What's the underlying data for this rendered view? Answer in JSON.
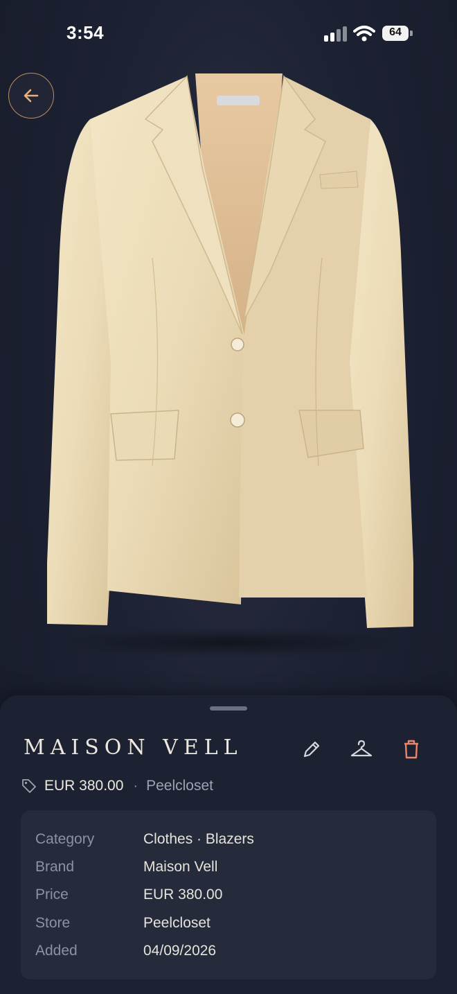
{
  "status_bar": {
    "time": "3:54",
    "battery_level": "64"
  },
  "icons": {
    "back": "arrow-left-icon",
    "edit": "pencil-icon",
    "wear": "hanger-icon",
    "delete": "trash-icon",
    "price_tag": "tag-icon"
  },
  "colors": {
    "accent": "#e8b07a",
    "delete": "#e9866c",
    "background": "#1d2233"
  },
  "item": {
    "brand_title": "MAISON VELL",
    "price": "EUR 380.00",
    "separator": "·",
    "store": "Peelcloset"
  },
  "details": [
    {
      "label": "Category",
      "value": "Clothes · Blazers"
    },
    {
      "label": "Brand",
      "value": "Maison Vell"
    },
    {
      "label": "Price",
      "value": "EUR 380.00"
    },
    {
      "label": "Store",
      "value": "Peelcloset"
    },
    {
      "label": "Added",
      "value": "04/09/2026"
    }
  ]
}
